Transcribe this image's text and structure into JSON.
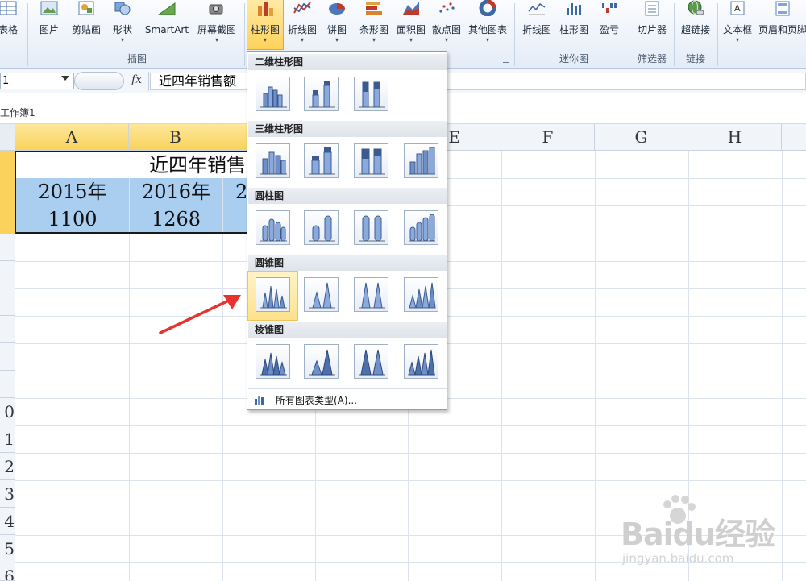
{
  "ribbon": {
    "buttons": [
      {
        "label": "表格"
      },
      {
        "label": "图片"
      },
      {
        "label": "剪贴画"
      },
      {
        "label": "形状"
      },
      {
        "label": "SmartArt"
      },
      {
        "label": "屏幕截图"
      },
      {
        "label": "柱形图"
      },
      {
        "label": "折线图"
      },
      {
        "label": "饼图"
      },
      {
        "label": "条形图"
      },
      {
        "label": "面积图"
      },
      {
        "label": "散点图"
      },
      {
        "label": "其他图表"
      },
      {
        "label": "折线图"
      },
      {
        "label": "柱形图"
      },
      {
        "label": "盈亏"
      },
      {
        "label": "切片器"
      },
      {
        "label": "超链接"
      },
      {
        "label": "文本框"
      },
      {
        "label": "页眉和页脚"
      }
    ],
    "groups": [
      "插图",
      "迷你图",
      "筛选器",
      "链接"
    ]
  },
  "formula_bar": {
    "name_box": "1",
    "fx": "fx",
    "content": "近四年销售额"
  },
  "workbook_title": "工作簿1",
  "columns": [
    "A",
    "B",
    "E",
    "F",
    "G",
    "H"
  ],
  "rows": [
    "0",
    "1",
    "2",
    "3",
    "4",
    "5",
    "6"
  ],
  "cells": {
    "title": "近四年销售",
    "y2015": "2015年",
    "y2016": "2016年",
    "y2017_partial": "2",
    "v2015": "1100",
    "v2016": "1268"
  },
  "dropdown": {
    "sections": [
      "二维柱形图",
      "三维柱形图",
      "圆柱图",
      "圆锥图",
      "棱锥图"
    ],
    "all_types": "所有图表类型(A)..."
  },
  "watermark": {
    "brand": "Baidu经验",
    "url": "jingyan.baidu.com"
  }
}
